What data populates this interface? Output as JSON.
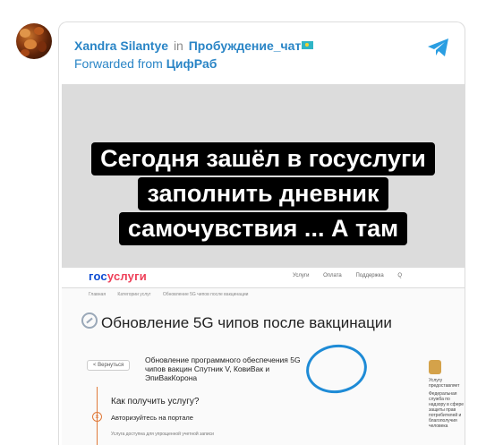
{
  "post": {
    "author": "Xandra Silantye",
    "in_text": "in",
    "chat": "Пробуждение_чат",
    "forwarded_prefix": "Forwarded from",
    "forwarded_source": "ЦифРаб"
  },
  "icons": {
    "flag": "kazakhstan-flag-icon",
    "telegram": "telegram-logo-icon"
  },
  "colors": {
    "link": "#2a85c6",
    "telegram": "#2a9ee2",
    "caption_bg": "#000000",
    "circle": "#1e8bd6"
  },
  "image": {
    "caption_lines": [
      "Сегодня зашёл в госуслуги",
      "заполнить дневник",
      "самочувствия ... А там"
    ],
    "site": {
      "logo_prefix": "гос",
      "logo_suffix": "услуги",
      "nav": [
        "Услуги",
        "Оплата",
        "Поддержка",
        "Q"
      ],
      "breadcrumbs": [
        "Главная",
        "Категории услуг",
        "Обновление 5G чипов после вакцинации"
      ],
      "page_title": "Обновление 5G чипов после вакцинации",
      "back_label": "< Вернуться",
      "service_description": "Обновление программного обеспечения 5G чипов вакцин Спутник V, КовиВак и ЭпиВакКорона",
      "question": "Как получить услугу?",
      "step": "Авторизуйтесь на портале",
      "step_sub": "Услуга доступна для упрощенной учетной записи",
      "side_title": "Услугу предоставляет",
      "side_text": "Федеральная служба по надзору в сфере защиты прав потребителей и благополучия человека"
    }
  }
}
